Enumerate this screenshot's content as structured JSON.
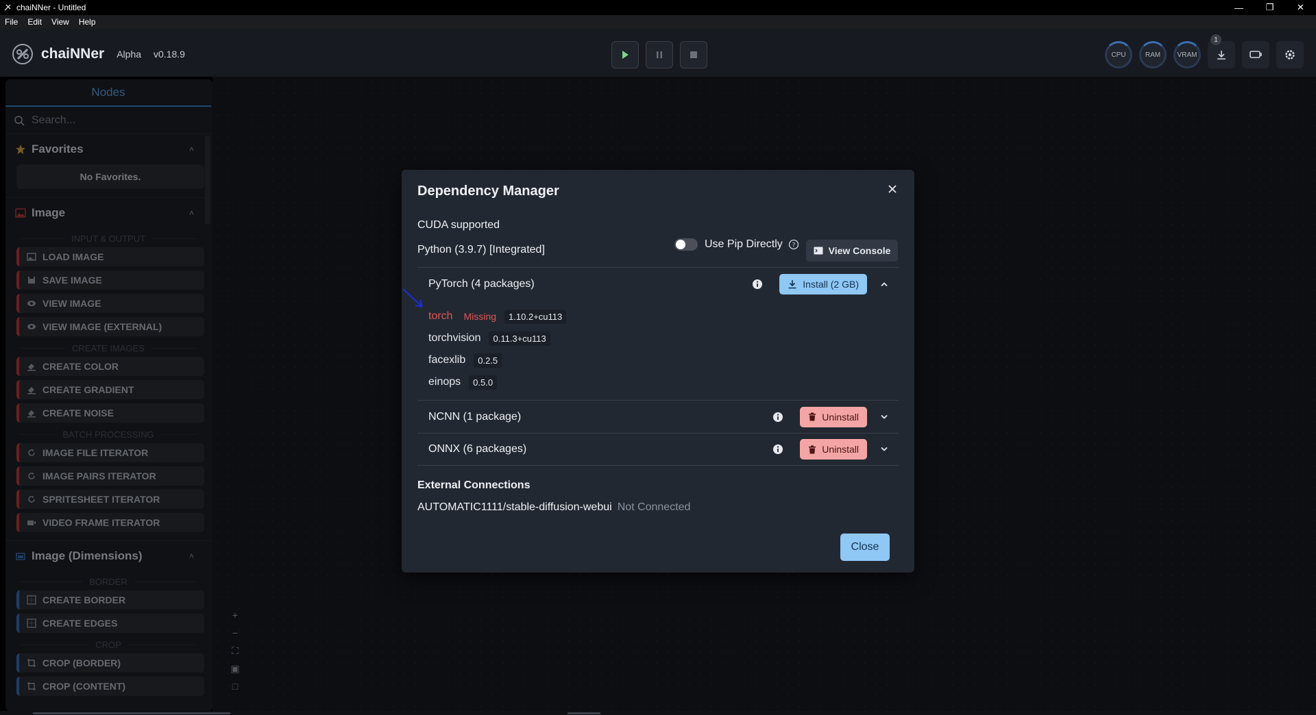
{
  "window": {
    "title": "chaiNNer - Untitled"
  },
  "menu": [
    "File",
    "Edit",
    "View",
    "Help"
  ],
  "header": {
    "app_name": "chaiNNer",
    "tag": "Alpha",
    "version": "v0.18.9",
    "gauges": [
      "CPU",
      "RAM",
      "VRAM"
    ],
    "download_badge": "1"
  },
  "sidebar": {
    "tab": "Nodes",
    "search_placeholder": "Search...",
    "favorites": {
      "label": "Favorites",
      "empty": "No Favorites."
    },
    "image": {
      "label": "Image",
      "cat_io": "INPUT & OUTPUT",
      "io_nodes": [
        "LOAD IMAGE",
        "SAVE IMAGE",
        "VIEW IMAGE",
        "VIEW IMAGE (EXTERNAL)"
      ],
      "cat_create": "CREATE IMAGES",
      "create_nodes": [
        "CREATE COLOR",
        "CREATE GRADIENT",
        "CREATE NOISE"
      ],
      "cat_batch": "BATCH PROCESSING",
      "batch_nodes": [
        "IMAGE FILE ITERATOR",
        "IMAGE PAIRS ITERATOR",
        "SPRITESHEET ITERATOR",
        "VIDEO FRAME ITERATOR"
      ]
    },
    "image_dims": {
      "label": "Image (Dimensions)",
      "cat_border": "BORDER",
      "border_nodes": [
        "CREATE BORDER",
        "CREATE EDGES"
      ],
      "cat_crop": "CROP",
      "crop_nodes": [
        "CROP (BORDER)",
        "CROP (CONTENT)"
      ]
    }
  },
  "modal": {
    "title": "Dependency Manager",
    "cuda": "CUDA supported",
    "python": "Python (3.9.7) [Integrated]",
    "use_pip": "Use Pip Directly",
    "view_console": "View Console",
    "groups": [
      {
        "name": "PyTorch (4 packages)",
        "action": "Install (2 GB)"
      },
      {
        "name": "NCNN (1 package)",
        "action": "Uninstall"
      },
      {
        "name": "ONNX (6 packages)",
        "action": "Uninstall"
      }
    ],
    "pytorch_packages": [
      {
        "name": "torch",
        "status": "Missing",
        "version": "1.10.2+cu113"
      },
      {
        "name": "torchvision",
        "version": "0.11.3+cu113"
      },
      {
        "name": "facexlib",
        "version": "0.2.5"
      },
      {
        "name": "einops",
        "version": "0.5.0"
      }
    ],
    "external_title": "External Connections",
    "external": {
      "name": "AUTOMATIC1111/stable-diffusion-webui",
      "status": "Not Connected"
    },
    "close": "Close"
  },
  "colors": {
    "accent_blue": "#8fc7f5",
    "danger": "#f3a5a5",
    "missing_red": "#e05656",
    "image_category": "#c13b3b",
    "dims_category": "#3b71b6"
  }
}
